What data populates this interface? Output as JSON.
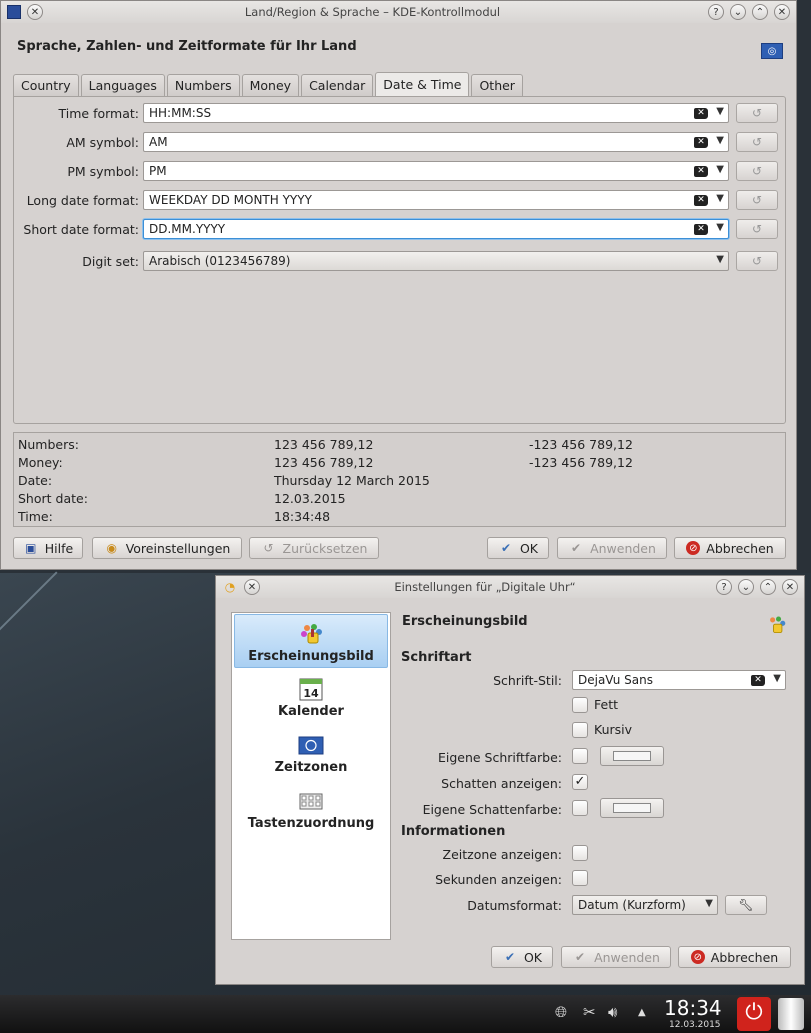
{
  "window1": {
    "title": "Land/Region & Sprache – KDE-Kontrollmodul",
    "heading": "Sprache, Zahlen- und Zeitformate für Ihr Land",
    "tabs": [
      "Country",
      "Languages",
      "Numbers",
      "Money",
      "Calendar",
      "Date & Time",
      "Other"
    ],
    "active_tab": "Date & Time",
    "fields": [
      {
        "label": "Time format:",
        "value": "HH:MM:SS"
      },
      {
        "label": "AM symbol:",
        "value": "AM"
      },
      {
        "label": "PM symbol:",
        "value": "PM"
      },
      {
        "label": "Long date format:",
        "value": "WEEKDAY DD MONTH YYYY"
      },
      {
        "label": "Short date format:",
        "value": "DD.MM.YYYY"
      }
    ],
    "digit_set": {
      "label": "Digit set:",
      "value": "Arabisch (0123456789)"
    },
    "preview": [
      {
        "label": "Numbers:",
        "v1": "123 456 789,12",
        "v2": "-123 456 789,12"
      },
      {
        "label": "Money:",
        "v1": "123 456 789,12",
        "v2": "-123 456 789,12"
      },
      {
        "label": "Date:",
        "v1": "Thursday 12 March 2015",
        "v2": ""
      },
      {
        "label": "Short date:",
        "v1": "12.03.2015",
        "v2": ""
      },
      {
        "label": "Time:",
        "v1": "18:34:48",
        "v2": ""
      }
    ],
    "buttons": {
      "help": "Hilfe",
      "defaults": "Voreinstellungen",
      "reset": "Zurücksetzen",
      "ok": "OK",
      "apply": "Anwenden",
      "cancel": "Abbrechen"
    }
  },
  "window2": {
    "title": "Einstellungen für „Digitale Uhr“",
    "nav": [
      "Erscheinungsbild",
      "Kalender",
      "Zeitzonen",
      "Tastenzuordnung"
    ],
    "calendar_day": "14",
    "selected_nav": "Erscheinungsbild",
    "section_title": "Erscheinungsbild",
    "group_font": "Schriftart",
    "font_style_label": "Schrift-Stil:",
    "font_style_value": "DejaVu Sans",
    "bold_label": "Fett",
    "italic_label": "Kursiv",
    "own_font_color_label": "Eigene Schriftfarbe:",
    "show_shadow_label": "Schatten anzeigen:",
    "own_shadow_color_label": "Eigene Schattenfarbe:",
    "group_info": "Informationen",
    "show_timezone_label": "Zeitzone anzeigen:",
    "show_seconds_label": "Sekunden anzeigen:",
    "date_format_label": "Datumsformat:",
    "date_format_value": "Datum (Kurzform)",
    "buttons": {
      "ok": "OK",
      "apply": "Anwenden",
      "cancel": "Abbrechen"
    }
  },
  "taskbar": {
    "time": "18:34",
    "date": "12.03.2015"
  },
  "icons": [
    "close-icon",
    "help-icon",
    "minimize-icon",
    "maximize-icon",
    "clear-icon",
    "chevron-down-icon",
    "reset-icon",
    "wrench-icon",
    "power-icon",
    "trash-icon",
    "network-icon",
    "volume-icon",
    "clipboard-icon"
  ]
}
